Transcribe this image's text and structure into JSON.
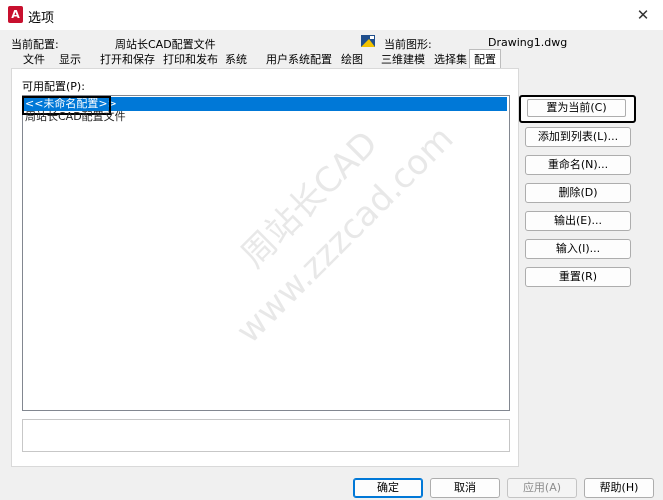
{
  "window": {
    "title": "选项",
    "close_glyph": "✕",
    "app_icon_glyph": "A"
  },
  "current_profile": {
    "label": "当前配置:",
    "value": "周站长CAD配置文件"
  },
  "current_drawing": {
    "label": "当前图形:",
    "value": "Drawing1.dwg"
  },
  "tabs": [
    "文件",
    "显示",
    "打开和保存",
    "打印和发布",
    "系统",
    "用户系统配置",
    "绘图",
    "三维建模",
    "选择集",
    "配置"
  ],
  "active_tab": "配置",
  "profiles": {
    "label": "可用配置(P):",
    "items": [
      "<<未命名配置>>",
      "周站长CAD配置文件"
    ],
    "selected_index": 0
  },
  "side_buttons": {
    "set_current": "置为当前(C)",
    "add_to_list": "添加到列表(L)...",
    "rename": "重命名(N)...",
    "delete": "删除(D)",
    "export": "输出(E)...",
    "import": "输入(I)...",
    "reset": "重置(R)"
  },
  "footer_buttons": {
    "ok": "确定",
    "cancel": "取消",
    "apply": "应用(A)",
    "help": "帮助(H)"
  },
  "watermark": {
    "line1": "周站长CAD",
    "line2": "www.zzzcad.com"
  },
  "colors": {
    "selection": "#0078d7",
    "app_icon": "#c8102e"
  }
}
